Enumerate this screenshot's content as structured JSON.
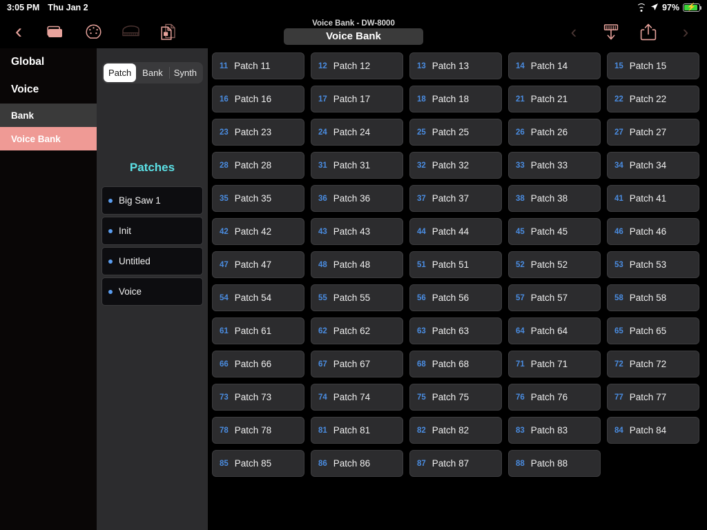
{
  "statusbar": {
    "time": "3:05 PM",
    "date": "Thu Jan 2",
    "battery_percent": "97%",
    "wifi_icon": "wifi-icon",
    "location_icon": "location-arrow-icon",
    "battery_icon": "battery-charging-icon"
  },
  "toolbar": {
    "back_icon": "chevron-left-icon",
    "icons": [
      {
        "name": "folder-icon",
        "label": "Folder"
      },
      {
        "name": "midi-connector-icon",
        "label": "MIDI"
      },
      {
        "name": "piano-icon",
        "label": "Piano"
      },
      {
        "name": "documents-copy-icon",
        "label": "Documents"
      }
    ],
    "subtitle": "Voice Bank - DW-8000",
    "title": "Voice Bank",
    "prev_icon": "chevron-left-icon",
    "receive_icon": "receive-from-synth-icon",
    "share_icon": "share-export-icon",
    "next_icon": "chevron-right-icon"
  },
  "sidebar": {
    "sections": [
      {
        "type": "header",
        "label": "Global",
        "state": "normal"
      },
      {
        "type": "header",
        "label": "Voice",
        "state": "normal"
      },
      {
        "type": "item",
        "label": "Bank",
        "state": "gray"
      },
      {
        "type": "item",
        "label": "Voice Bank",
        "state": "active"
      }
    ],
    "active_color": "#ef9a95"
  },
  "midpanel": {
    "segmented": {
      "options": [
        "Patch",
        "Bank",
        "Synth"
      ],
      "selected": "Patch"
    },
    "section_title": "Patches",
    "section_title_color": "#5ce1e6",
    "patches": [
      {
        "name": "Big Saw 1"
      },
      {
        "name": "Init"
      },
      {
        "name": "Untitled"
      },
      {
        "name": "Voice"
      }
    ],
    "bullet_color": "#5a9df0"
  },
  "grid": {
    "columns": 5,
    "number_color": "#4a8ce0",
    "cells": [
      {
        "num": "11",
        "label": "Patch 11"
      },
      {
        "num": "12",
        "label": "Patch 12"
      },
      {
        "num": "13",
        "label": "Patch 13"
      },
      {
        "num": "14",
        "label": "Patch 14"
      },
      {
        "num": "15",
        "label": "Patch 15"
      },
      {
        "num": "16",
        "label": "Patch 16"
      },
      {
        "num": "17",
        "label": "Patch 17"
      },
      {
        "num": "18",
        "label": "Patch 18"
      },
      {
        "num": "21",
        "label": "Patch 21"
      },
      {
        "num": "22",
        "label": "Patch 22"
      },
      {
        "num": "23",
        "label": "Patch 23"
      },
      {
        "num": "24",
        "label": "Patch 24"
      },
      {
        "num": "25",
        "label": "Patch 25"
      },
      {
        "num": "26",
        "label": "Patch 26"
      },
      {
        "num": "27",
        "label": "Patch 27"
      },
      {
        "num": "28",
        "label": "Patch 28"
      },
      {
        "num": "31",
        "label": "Patch 31"
      },
      {
        "num": "32",
        "label": "Patch 32"
      },
      {
        "num": "33",
        "label": "Patch 33"
      },
      {
        "num": "34",
        "label": "Patch 34"
      },
      {
        "num": "35",
        "label": "Patch 35"
      },
      {
        "num": "36",
        "label": "Patch 36"
      },
      {
        "num": "37",
        "label": "Patch 37"
      },
      {
        "num": "38",
        "label": "Patch 38"
      },
      {
        "num": "41",
        "label": "Patch 41"
      },
      {
        "num": "42",
        "label": "Patch 42"
      },
      {
        "num": "43",
        "label": "Patch 43"
      },
      {
        "num": "44",
        "label": "Patch 44"
      },
      {
        "num": "45",
        "label": "Patch 45"
      },
      {
        "num": "46",
        "label": "Patch 46"
      },
      {
        "num": "47",
        "label": "Patch 47"
      },
      {
        "num": "48",
        "label": "Patch 48"
      },
      {
        "num": "51",
        "label": "Patch 51"
      },
      {
        "num": "52",
        "label": "Patch 52"
      },
      {
        "num": "53",
        "label": "Patch 53"
      },
      {
        "num": "54",
        "label": "Patch 54"
      },
      {
        "num": "55",
        "label": "Patch 55"
      },
      {
        "num": "56",
        "label": "Patch 56"
      },
      {
        "num": "57",
        "label": "Patch 57"
      },
      {
        "num": "58",
        "label": "Patch 58"
      },
      {
        "num": "61",
        "label": "Patch 61"
      },
      {
        "num": "62",
        "label": "Patch 62"
      },
      {
        "num": "63",
        "label": "Patch 63"
      },
      {
        "num": "64",
        "label": "Patch 64"
      },
      {
        "num": "65",
        "label": "Patch 65"
      },
      {
        "num": "66",
        "label": "Patch 66"
      },
      {
        "num": "67",
        "label": "Patch 67"
      },
      {
        "num": "68",
        "label": "Patch 68"
      },
      {
        "num": "71",
        "label": "Patch 71"
      },
      {
        "num": "72",
        "label": "Patch 72"
      },
      {
        "num": "73",
        "label": "Patch 73"
      },
      {
        "num": "74",
        "label": "Patch 74"
      },
      {
        "num": "75",
        "label": "Patch 75"
      },
      {
        "num": "76",
        "label": "Patch 76"
      },
      {
        "num": "77",
        "label": "Patch 77"
      },
      {
        "num": "78",
        "label": "Patch 78"
      },
      {
        "num": "81",
        "label": "Patch 81"
      },
      {
        "num": "82",
        "label": "Patch 82"
      },
      {
        "num": "83",
        "label": "Patch 83"
      },
      {
        "num": "84",
        "label": "Patch 84"
      },
      {
        "num": "85",
        "label": "Patch 85"
      },
      {
        "num": "86",
        "label": "Patch 86"
      },
      {
        "num": "87",
        "label": "Patch 87"
      },
      {
        "num": "88",
        "label": "Patch 88"
      }
    ]
  }
}
